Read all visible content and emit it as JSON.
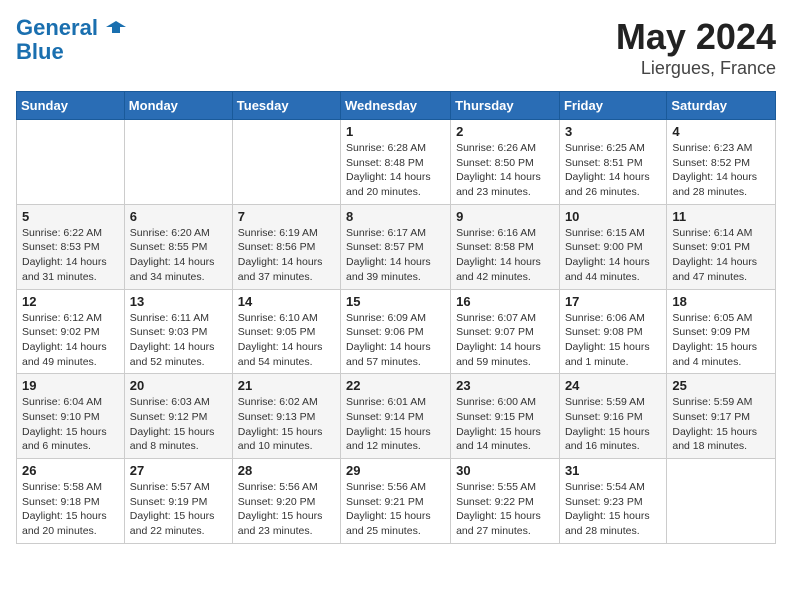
{
  "header": {
    "logo_line1": "General",
    "logo_line2": "Blue",
    "title": "May 2024",
    "subtitle": "Liergues, France"
  },
  "weekdays": [
    "Sunday",
    "Monday",
    "Tuesday",
    "Wednesday",
    "Thursday",
    "Friday",
    "Saturday"
  ],
  "weeks": [
    [
      {
        "day": "",
        "info": ""
      },
      {
        "day": "",
        "info": ""
      },
      {
        "day": "",
        "info": ""
      },
      {
        "day": "1",
        "info": "Sunrise: 6:28 AM\nSunset: 8:48 PM\nDaylight: 14 hours\nand 20 minutes."
      },
      {
        "day": "2",
        "info": "Sunrise: 6:26 AM\nSunset: 8:50 PM\nDaylight: 14 hours\nand 23 minutes."
      },
      {
        "day": "3",
        "info": "Sunrise: 6:25 AM\nSunset: 8:51 PM\nDaylight: 14 hours\nand 26 minutes."
      },
      {
        "day": "4",
        "info": "Sunrise: 6:23 AM\nSunset: 8:52 PM\nDaylight: 14 hours\nand 28 minutes."
      }
    ],
    [
      {
        "day": "5",
        "info": "Sunrise: 6:22 AM\nSunset: 8:53 PM\nDaylight: 14 hours\nand 31 minutes."
      },
      {
        "day": "6",
        "info": "Sunrise: 6:20 AM\nSunset: 8:55 PM\nDaylight: 14 hours\nand 34 minutes."
      },
      {
        "day": "7",
        "info": "Sunrise: 6:19 AM\nSunset: 8:56 PM\nDaylight: 14 hours\nand 37 minutes."
      },
      {
        "day": "8",
        "info": "Sunrise: 6:17 AM\nSunset: 8:57 PM\nDaylight: 14 hours\nand 39 minutes."
      },
      {
        "day": "9",
        "info": "Sunrise: 6:16 AM\nSunset: 8:58 PM\nDaylight: 14 hours\nand 42 minutes."
      },
      {
        "day": "10",
        "info": "Sunrise: 6:15 AM\nSunset: 9:00 PM\nDaylight: 14 hours\nand 44 minutes."
      },
      {
        "day": "11",
        "info": "Sunrise: 6:14 AM\nSunset: 9:01 PM\nDaylight: 14 hours\nand 47 minutes."
      }
    ],
    [
      {
        "day": "12",
        "info": "Sunrise: 6:12 AM\nSunset: 9:02 PM\nDaylight: 14 hours\nand 49 minutes."
      },
      {
        "day": "13",
        "info": "Sunrise: 6:11 AM\nSunset: 9:03 PM\nDaylight: 14 hours\nand 52 minutes."
      },
      {
        "day": "14",
        "info": "Sunrise: 6:10 AM\nSunset: 9:05 PM\nDaylight: 14 hours\nand 54 minutes."
      },
      {
        "day": "15",
        "info": "Sunrise: 6:09 AM\nSunset: 9:06 PM\nDaylight: 14 hours\nand 57 minutes."
      },
      {
        "day": "16",
        "info": "Sunrise: 6:07 AM\nSunset: 9:07 PM\nDaylight: 14 hours\nand 59 minutes."
      },
      {
        "day": "17",
        "info": "Sunrise: 6:06 AM\nSunset: 9:08 PM\nDaylight: 15 hours\nand 1 minute."
      },
      {
        "day": "18",
        "info": "Sunrise: 6:05 AM\nSunset: 9:09 PM\nDaylight: 15 hours\nand 4 minutes."
      }
    ],
    [
      {
        "day": "19",
        "info": "Sunrise: 6:04 AM\nSunset: 9:10 PM\nDaylight: 15 hours\nand 6 minutes."
      },
      {
        "day": "20",
        "info": "Sunrise: 6:03 AM\nSunset: 9:12 PM\nDaylight: 15 hours\nand 8 minutes."
      },
      {
        "day": "21",
        "info": "Sunrise: 6:02 AM\nSunset: 9:13 PM\nDaylight: 15 hours\nand 10 minutes."
      },
      {
        "day": "22",
        "info": "Sunrise: 6:01 AM\nSunset: 9:14 PM\nDaylight: 15 hours\nand 12 minutes."
      },
      {
        "day": "23",
        "info": "Sunrise: 6:00 AM\nSunset: 9:15 PM\nDaylight: 15 hours\nand 14 minutes."
      },
      {
        "day": "24",
        "info": "Sunrise: 5:59 AM\nSunset: 9:16 PM\nDaylight: 15 hours\nand 16 minutes."
      },
      {
        "day": "25",
        "info": "Sunrise: 5:59 AM\nSunset: 9:17 PM\nDaylight: 15 hours\nand 18 minutes."
      }
    ],
    [
      {
        "day": "26",
        "info": "Sunrise: 5:58 AM\nSunset: 9:18 PM\nDaylight: 15 hours\nand 20 minutes."
      },
      {
        "day": "27",
        "info": "Sunrise: 5:57 AM\nSunset: 9:19 PM\nDaylight: 15 hours\nand 22 minutes."
      },
      {
        "day": "28",
        "info": "Sunrise: 5:56 AM\nSunset: 9:20 PM\nDaylight: 15 hours\nand 23 minutes."
      },
      {
        "day": "29",
        "info": "Sunrise: 5:56 AM\nSunset: 9:21 PM\nDaylight: 15 hours\nand 25 minutes."
      },
      {
        "day": "30",
        "info": "Sunrise: 5:55 AM\nSunset: 9:22 PM\nDaylight: 15 hours\nand 27 minutes."
      },
      {
        "day": "31",
        "info": "Sunrise: 5:54 AM\nSunset: 9:23 PM\nDaylight: 15 hours\nand 28 minutes."
      },
      {
        "day": "",
        "info": ""
      }
    ]
  ]
}
